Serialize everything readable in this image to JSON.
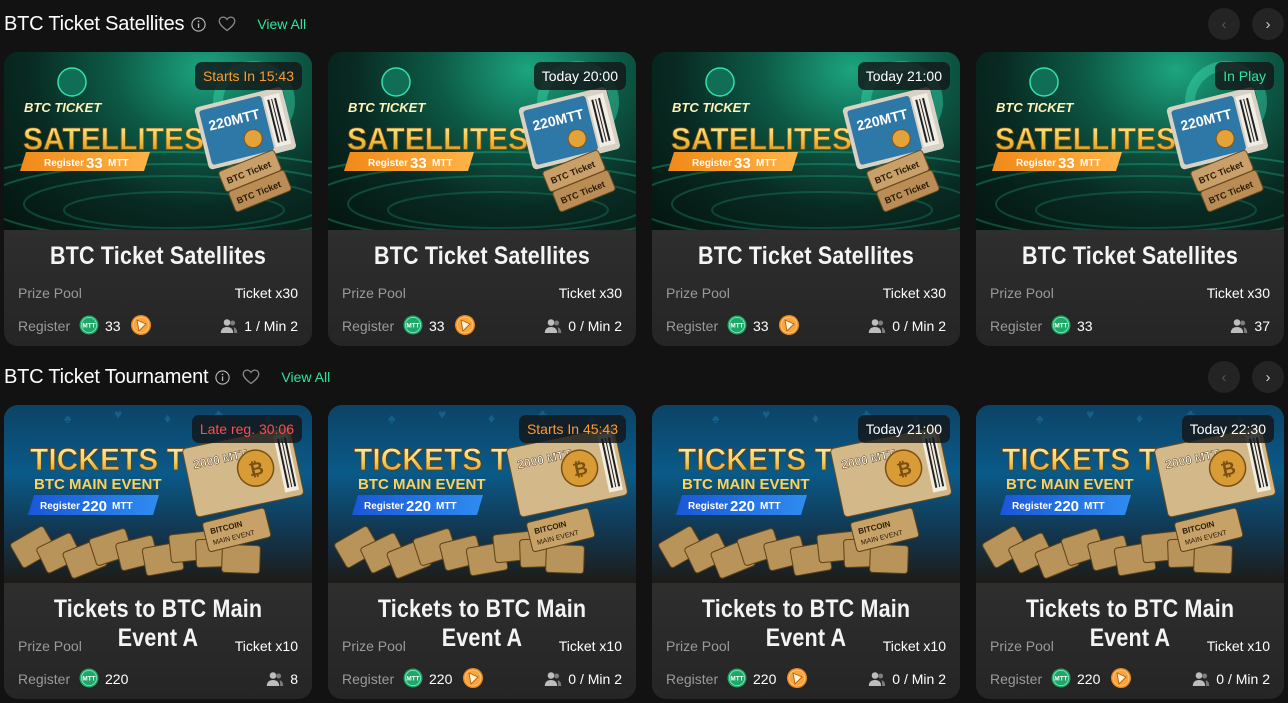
{
  "colors": {
    "accent_green": "#2ee59d",
    "badge_orange": "#ff9a2e",
    "badge_red": "#ff4d4f",
    "badge_white": "#ffffff",
    "badge_green": "#2ee59d",
    "background": "#121212"
  },
  "sections": [
    {
      "title": "BTC Ticket Satellites",
      "view_all": "View All",
      "cards": [
        {
          "badge": "Starts In 15:43",
          "badge_color": "#ff9a2e",
          "title": "BTC Ticket Satellites",
          "prize_label": "Prize Pool",
          "prize_value": "Ticket x30",
          "register_label": "Register",
          "register_value": "33",
          "has_ticket_icon": true,
          "players": "1 / Min 2"
        },
        {
          "badge": "Today 20:00",
          "badge_color": "#ffffff",
          "title": "BTC Ticket Satellites",
          "prize_label": "Prize Pool",
          "prize_value": "Ticket x30",
          "register_label": "Register",
          "register_value": "33",
          "has_ticket_icon": true,
          "players": "0 / Min 2"
        },
        {
          "badge": "Today 21:00",
          "badge_color": "#ffffff",
          "title": "BTC Ticket Satellites",
          "prize_label": "Prize Pool",
          "prize_value": "Ticket x30",
          "register_label": "Register",
          "register_value": "33",
          "has_ticket_icon": true,
          "players": "0 / Min 2"
        },
        {
          "badge": "In Play",
          "badge_color": "#2ee59d",
          "title": "BTC Ticket Satellites",
          "prize_label": "Prize Pool",
          "prize_value": "Ticket x30",
          "register_label": "Register",
          "register_value": "33",
          "has_ticket_icon": false,
          "players": "37"
        }
      ],
      "banner": {
        "line1": "BTC TICKET",
        "line2": "SATELLITES",
        "reg_prefix": "Register",
        "reg_amount": "33",
        "reg_suffix": "MTT",
        "ticket_text": "220MTT",
        "stub1": "BTC Ticket",
        "stub2": "BTC Ticket"
      }
    },
    {
      "title": "BTC Ticket Tournament",
      "view_all": "View All",
      "cards": [
        {
          "badge": "Late reg. 30:06",
          "badge_color": "#ff4d4f",
          "title": "Tickets to BTC Main Event A",
          "prize_label": "Prize Pool",
          "prize_value": "Ticket x10",
          "register_label": "Register",
          "register_value": "220",
          "has_ticket_icon": false,
          "players": "8"
        },
        {
          "badge": "Starts In 45:43",
          "badge_color": "#ff9a2e",
          "title": "Tickets to BTC Main Event A",
          "prize_label": "Prize Pool",
          "prize_value": "Ticket x10",
          "register_label": "Register",
          "register_value": "220",
          "has_ticket_icon": true,
          "players": "0 / Min 2"
        },
        {
          "badge": "Today 21:00",
          "badge_color": "#ffffff",
          "title": "Tickets to BTC Main Event A",
          "prize_label": "Prize Pool",
          "prize_value": "Ticket x10",
          "register_label": "Register",
          "register_value": "220",
          "has_ticket_icon": true,
          "players": "0 / Min 2"
        },
        {
          "badge": "Today 22:30",
          "badge_color": "#ffffff",
          "title": "Tickets to BTC Main Event A",
          "prize_label": "Prize Pool",
          "prize_value": "Ticket x10",
          "register_label": "Register",
          "register_value": "220",
          "has_ticket_icon": true,
          "players": "0 / Min 2"
        }
      ],
      "banner": {
        "line1": "TICKETS TO",
        "line2": "BTC MAIN EVENT",
        "reg_prefix": "Register",
        "reg_amount": "220",
        "reg_suffix": "MTT",
        "ticket_text": "2000 MTT",
        "stub1": "BITCOIN",
        "stub2": "MAIN EVENT"
      }
    }
  ],
  "icons": {
    "info": "info-icon",
    "favorite": "heart-icon",
    "prev": "chevron-left-icon",
    "next": "chevron-right-icon",
    "coin": "mtt-coin-icon",
    "ticket": "ticket-icon",
    "players": "players-icon"
  }
}
